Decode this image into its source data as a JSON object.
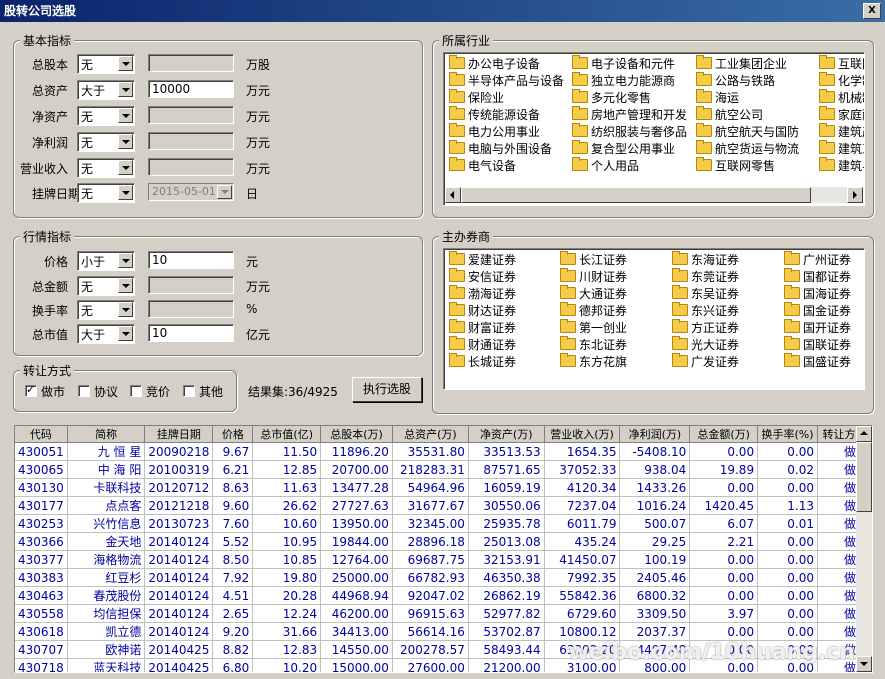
{
  "window": {
    "title": "股转公司选股",
    "close": "X"
  },
  "basic": {
    "legend": "基本指标",
    "rows": [
      {
        "label": "总股本",
        "op": "无",
        "value": "",
        "unit": "万股"
      },
      {
        "label": "总资产",
        "op": "大于",
        "value": "10000",
        "unit": "万元"
      },
      {
        "label": "净资产",
        "op": "无",
        "value": "",
        "unit": "万元"
      },
      {
        "label": "净利润",
        "op": "无",
        "value": "",
        "unit": "万元"
      },
      {
        "label": "营业收入",
        "op": "无",
        "value": "",
        "unit": "万元"
      },
      {
        "label": "挂牌日期",
        "op": "无",
        "value": "2015-05-01",
        "unit": "日"
      }
    ]
  },
  "market": {
    "legend": "行情指标",
    "rows": [
      {
        "label": "价格",
        "op": "小于",
        "value": "10",
        "unit": "元"
      },
      {
        "label": "总金额",
        "op": "无",
        "value": "",
        "unit": "万元"
      },
      {
        "label": "换手率",
        "op": "无",
        "value": "",
        "unit": "%"
      },
      {
        "label": "总市值",
        "op": "大于",
        "value": "10",
        "unit": "亿元"
      }
    ]
  },
  "transfer": {
    "legend": "转让方式",
    "options": [
      {
        "label": "做市",
        "checked": true
      },
      {
        "label": "协议",
        "checked": false
      },
      {
        "label": "竞价",
        "checked": false
      },
      {
        "label": "其他",
        "checked": false
      }
    ],
    "result_label": "结果集:36/4925",
    "run_button": "执行选股"
  },
  "industry": {
    "legend": "所属行业",
    "columns": [
      [
        "办公电子设备",
        "半导体产品与设备",
        "保险业",
        "传统能源设备",
        "电力公用事业",
        "电脑与外围设备",
        "电气设备"
      ],
      [
        "电子设备和元件",
        "独立电力能源商",
        "多元化零售",
        "房地产管理和开发",
        "纺织服装与奢侈品",
        "复合型公用事业",
        "个人用品"
      ],
      [
        "工业集团企业",
        "公路与铁路",
        "海运",
        "航空公司",
        "航空航天与国防",
        "航空货运与物流",
        "互联网零售"
      ],
      [
        "互联网",
        "化学制",
        "机械制",
        "家庭耐",
        "建筑产",
        "建筑工",
        "建筑与"
      ]
    ]
  },
  "broker": {
    "legend": "主办券商",
    "columns": [
      [
        "爱建证券",
        "安信证券",
        "渤海证券",
        "财达证券",
        "财富证券",
        "财通证券",
        "长城证券"
      ],
      [
        "长江证券",
        "川财证券",
        "大通证券",
        "德邦证券",
        "第一创业",
        "东北证券",
        "东方花旗"
      ],
      [
        "东海证券",
        "东莞证券",
        "东吴证券",
        "东兴证券",
        "方正证券",
        "光大证券",
        "广发证券"
      ],
      [
        "广州证券",
        "国都证券",
        "国海证券",
        "国金证券",
        "国开证券",
        "国联证券",
        "国盛证券"
      ]
    ]
  },
  "table": {
    "headers": [
      "代码",
      "简称",
      "挂牌日期",
      "价格",
      "总市值(亿)",
      "总股本(万)",
      "总资产(万)",
      "净资产(万)",
      "营业收入(万)",
      "净利润(万)",
      "总金额(万)",
      "换手率(%)",
      "转让方式"
    ],
    "rows": [
      [
        "430051",
        "九 恒 星",
        "20090218",
        "9.67",
        "11.50",
        "11896.20",
        "35531.80",
        "33513.53",
        "1654.35",
        "-5408.10",
        "0.00",
        "0.00",
        "做市"
      ],
      [
        "430065",
        "中 海 阳",
        "20100319",
        "6.21",
        "12.85",
        "20700.00",
        "218283.31",
        "87571.65",
        "37052.33",
        "938.04",
        "19.89",
        "0.02",
        "做市"
      ],
      [
        "430130",
        "卡联科技",
        "20120712",
        "8.63",
        "11.63",
        "13477.28",
        "54964.96",
        "16059.19",
        "4120.34",
        "1433.26",
        "0.00",
        "0.00",
        "做市"
      ],
      [
        "430177",
        "点点客",
        "20121218",
        "9.60",
        "26.62",
        "27727.63",
        "31677.67",
        "30550.06",
        "7237.04",
        "1016.24",
        "1420.45",
        "1.13",
        "做市"
      ],
      [
        "430253",
        "兴竹信息",
        "20130723",
        "7.60",
        "10.60",
        "13950.00",
        "32345.00",
        "25935.78",
        "6011.79",
        "500.07",
        "6.07",
        "0.01",
        "做市"
      ],
      [
        "430366",
        "金天地",
        "20140124",
        "5.52",
        "10.95",
        "19844.00",
        "28896.18",
        "25013.08",
        "435.24",
        "29.25",
        "2.21",
        "0.00",
        "做市"
      ],
      [
        "430377",
        "海格物流",
        "20140124",
        "8.50",
        "10.85",
        "12764.00",
        "69687.75",
        "32153.91",
        "41450.07",
        "100.19",
        "0.00",
        "0.00",
        "做市"
      ],
      [
        "430383",
        "红豆杉",
        "20140124",
        "7.92",
        "19.80",
        "25000.00",
        "66782.93",
        "46350.38",
        "7992.35",
        "2405.46",
        "0.00",
        "0.00",
        "做市"
      ],
      [
        "430463",
        "春茂股份",
        "20140124",
        "4.51",
        "20.28",
        "44968.94",
        "92047.02",
        "26862.19",
        "55842.36",
        "6800.32",
        "0.00",
        "0.00",
        "做市"
      ],
      [
        "430558",
        "均信担保",
        "20140124",
        "2.65",
        "12.24",
        "46200.00",
        "96915.63",
        "52977.82",
        "6729.60",
        "3309.50",
        "3.97",
        "0.00",
        "做市"
      ],
      [
        "430618",
        "凯立德",
        "20140124",
        "9.20",
        "31.66",
        "34413.00",
        "56614.16",
        "53702.87",
        "10800.12",
        "2037.37",
        "0.00",
        "0.00",
        "做市"
      ],
      [
        "430707",
        "欧神诺",
        "20140425",
        "8.82",
        "12.83",
        "14550.00",
        "200278.57",
        "58493.44",
        "63392.20",
        "4497.48",
        "0.00",
        "0.00",
        "做市"
      ],
      [
        "430718",
        "蓝天科技",
        "20140425",
        "6.80",
        "10.20",
        "15000.00",
        "27600.00",
        "21200.00",
        "3100.00",
        "800.00",
        "0.00",
        "0.00",
        "做市"
      ]
    ]
  },
  "watermark": "weibo.com/10huang.cn"
}
